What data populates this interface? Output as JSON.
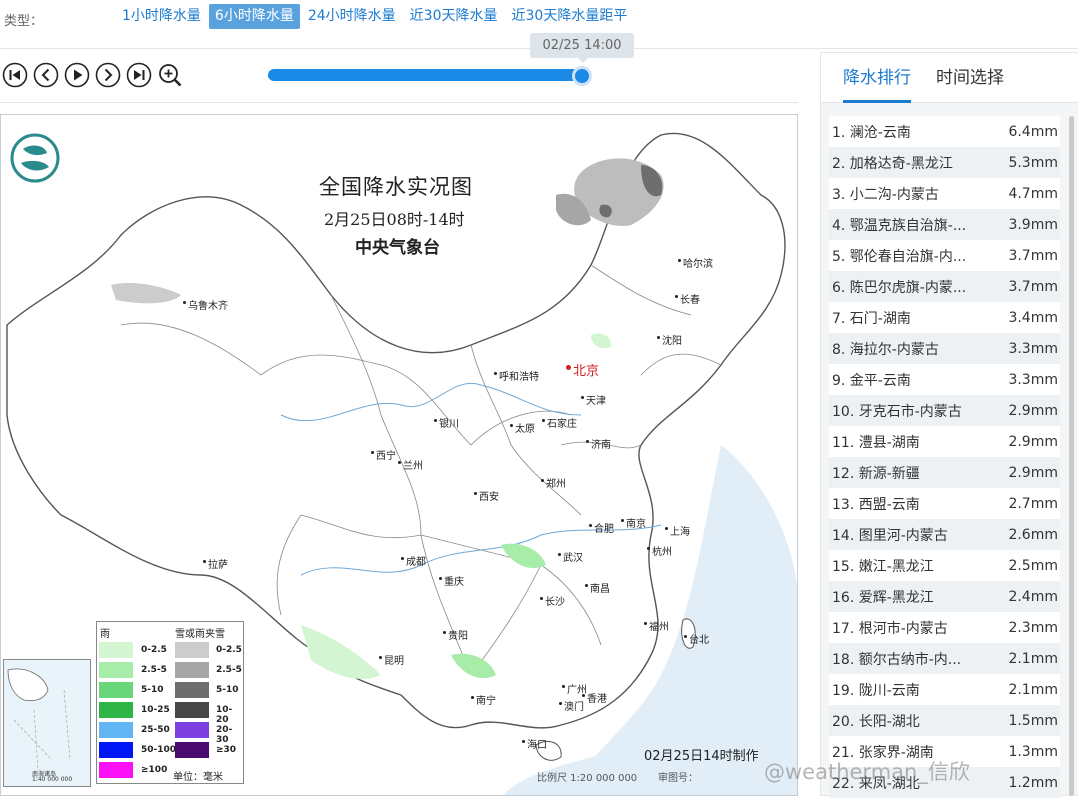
{
  "header": {
    "type_label": "类型：",
    "type_tabs": [
      {
        "label": "1小时降水量",
        "active": false
      },
      {
        "label": "6小时降水量",
        "active": true
      },
      {
        "label": "24小时降水量",
        "active": false
      },
      {
        "label": "近30天降水量",
        "active": false
      },
      {
        "label": "近30天降水量距平",
        "active": false
      }
    ]
  },
  "player": {
    "buttons": [
      "skip-to-start-icon",
      "previous-icon",
      "play-icon",
      "next-icon",
      "skip-to-end-icon",
      "zoom-in-icon"
    ],
    "slider_value_fraction": 1.0,
    "time_label": "02/25 14:00"
  },
  "map": {
    "title": "全国降水实况图",
    "date": "2月25日08时-14时",
    "agency": "中央气象台",
    "cities": [
      "乌鲁木齐",
      "哈尔滨",
      "长春",
      "沈阳",
      "北京",
      "天津",
      "呼和浩特",
      "石家庄",
      "太原",
      "济南",
      "银川",
      "西宁",
      "兰州",
      "郑州",
      "西安",
      "合肥",
      "南京",
      "上海",
      "杭州",
      "成都",
      "武汉",
      "重庆",
      "拉萨",
      "长沙",
      "南昌",
      "福州",
      "台北",
      "贵阳",
      "昆明",
      "南宁",
      "广州",
      "香港",
      "澳门",
      "海口"
    ],
    "made_by": "02月25日14时制作",
    "scale": "比例尺 1:20 000 000",
    "review_no": "审图号：",
    "inset_label": "南海诸岛",
    "inset_scale": "1:40 000 000",
    "legend": {
      "rain_title": "雨",
      "snow_title": "雪或雨夹雪",
      "rain": [
        {
          "label": "0-2.5",
          "color": "#d4f5d2"
        },
        {
          "label": "2.5-5",
          "color": "#a8ecaa"
        },
        {
          "label": "5-10",
          "color": "#6ad67a"
        },
        {
          "label": "10-25",
          "color": "#2fb446"
        },
        {
          "label": "25-50",
          "color": "#62b6f3"
        },
        {
          "label": "50-100",
          "color": "#0017f5"
        },
        {
          "label": "≥100",
          "color": "#fb10f8"
        }
      ],
      "snow": [
        {
          "label": "0-2.5",
          "color": "#cccccc"
        },
        {
          "label": "2.5-5",
          "color": "#a6a6a6"
        },
        {
          "label": "5-10",
          "color": "#6e6e6e"
        },
        {
          "label": "10-20",
          "color": "#474747"
        },
        {
          "label": "20-30",
          "color": "#7d40e0"
        },
        {
          "label": "≥30",
          "color": "#4a0b70"
        }
      ],
      "unit": "单位：毫米"
    }
  },
  "panel": {
    "tabs": [
      {
        "label": "降水排行",
        "active": true
      },
      {
        "label": "时间选择",
        "active": false
      }
    ],
    "ranking": [
      {
        "name": "1. 澜沧-云南",
        "value": "6.4mm"
      },
      {
        "name": "2. 加格达奇-黑龙江",
        "value": "5.3mm"
      },
      {
        "name": "3. 小二沟-内蒙古",
        "value": "4.7mm"
      },
      {
        "name": "4. 鄂温克族自治旗-...",
        "value": "3.9mm"
      },
      {
        "name": "5. 鄂伦春自治旗-内...",
        "value": "3.7mm"
      },
      {
        "name": "6. 陈巴尔虎旗-内蒙...",
        "value": "3.7mm"
      },
      {
        "name": "7. 石门-湖南",
        "value": "3.4mm"
      },
      {
        "name": "8. 海拉尔-内蒙古",
        "value": "3.3mm"
      },
      {
        "name": "9. 金平-云南",
        "value": "3.3mm"
      },
      {
        "name": "10. 牙克石市-内蒙古",
        "value": "2.9mm"
      },
      {
        "name": "11. 澧县-湖南",
        "value": "2.9mm"
      },
      {
        "name": "12. 新源-新疆",
        "value": "2.9mm"
      },
      {
        "name": "13. 西盟-云南",
        "value": "2.7mm"
      },
      {
        "name": "14. 图里河-内蒙古",
        "value": "2.6mm"
      },
      {
        "name": "15. 嫩江-黑龙江",
        "value": "2.5mm"
      },
      {
        "name": "16. 爱辉-黑龙江",
        "value": "2.4mm"
      },
      {
        "name": "17. 根河市-内蒙古",
        "value": "2.3mm"
      },
      {
        "name": "18. 额尔古纳市-内...",
        "value": "2.1mm"
      },
      {
        "name": "19. 陇川-云南",
        "value": "2.1mm"
      },
      {
        "name": "20. 长阳-湖北",
        "value": "1.5mm"
      },
      {
        "name": "21. 张家界-湖南",
        "value": "1.3mm"
      },
      {
        "name": "22. 来凤-湖北",
        "value": "1.2mm"
      }
    ]
  },
  "watermark": "@weatherman_信欣"
}
